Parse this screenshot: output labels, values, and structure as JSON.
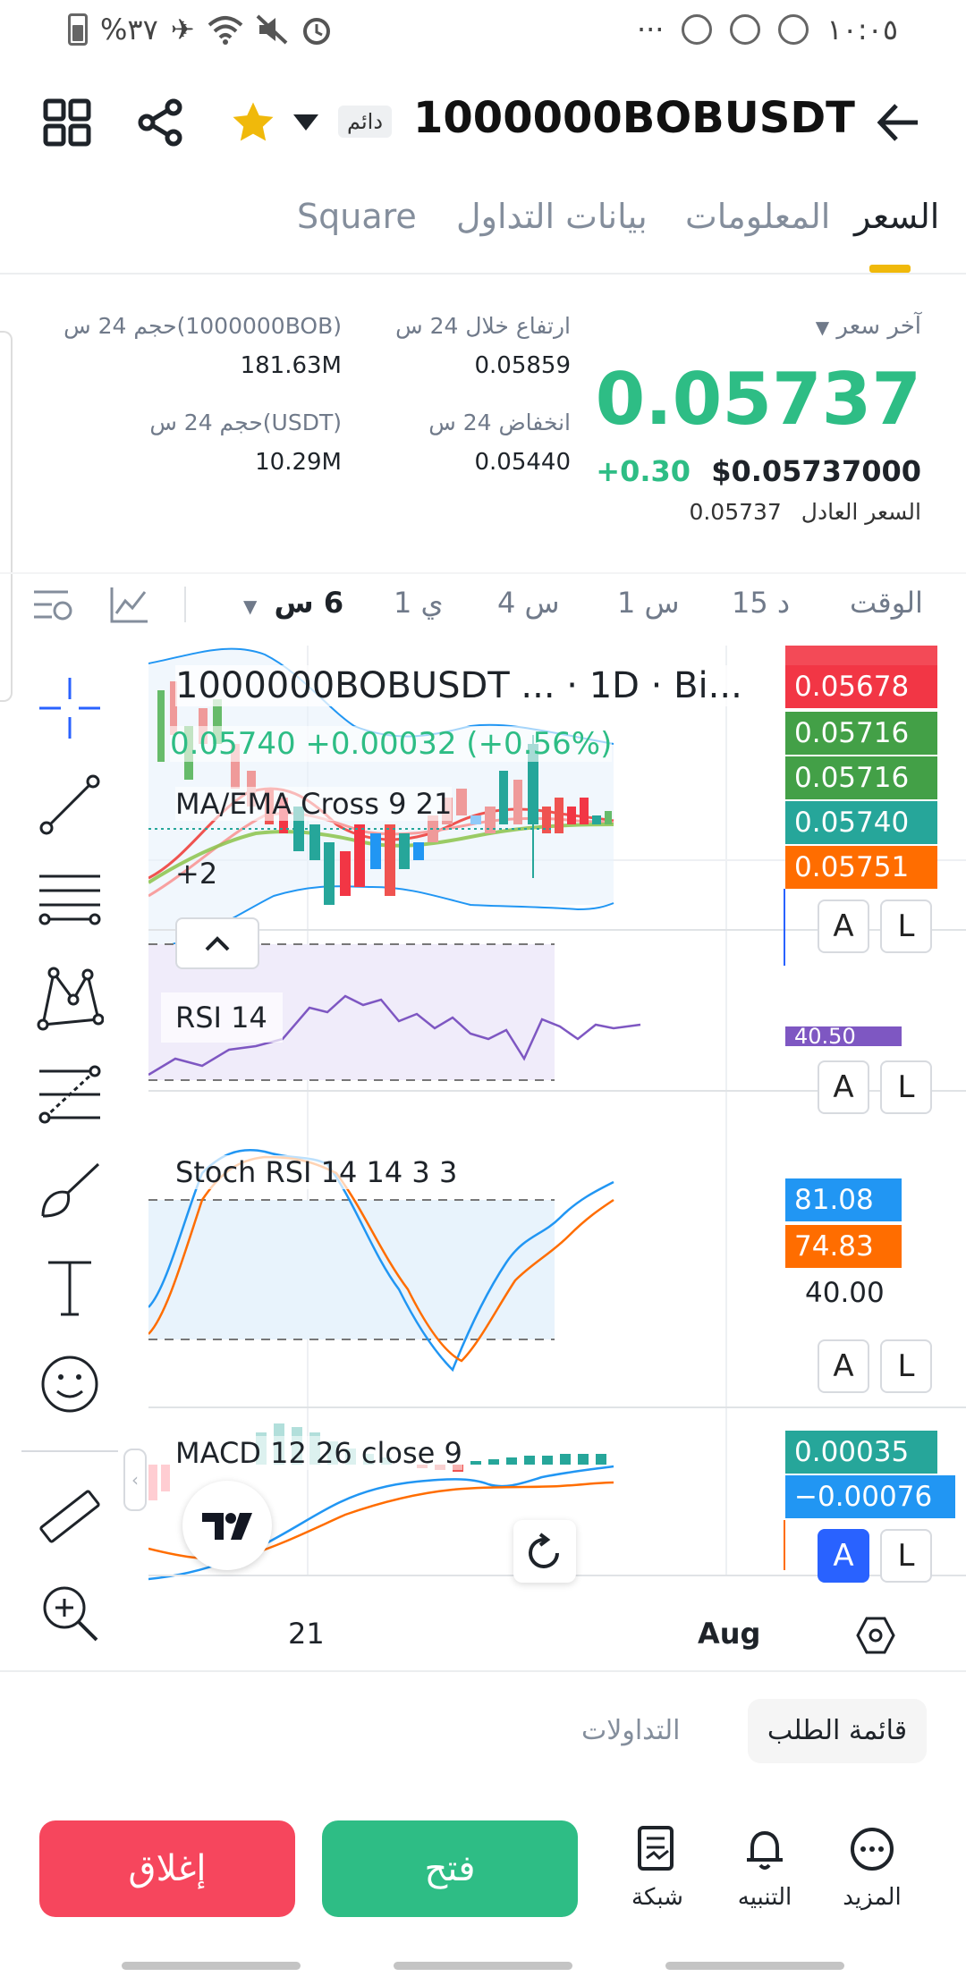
{
  "status_bar": {
    "battery_pct": "%٣٧",
    "time": "١٠:٠٥",
    "dots": "···"
  },
  "header": {
    "pair": "1000000BOBUSDT",
    "badge": "دائم"
  },
  "tabs": [
    {
      "label": "السعر"
    },
    {
      "label": "المعلومات"
    },
    {
      "label": "بيانات التداول"
    },
    {
      "label": "Square"
    }
  ],
  "price": {
    "last_label": "آخر سعر",
    "value": "0.05737",
    "change": "+0.30",
    "usd": "$0.05737000",
    "fair_label": "السعر العادل",
    "fair_value": "0.05737"
  },
  "stats": {
    "high_label": "ارتفاع خلال 24 س",
    "high_val": "0.05859",
    "low_label": "انخفاض 24 س",
    "low_val": "0.05440",
    "vol1_label": "حجم 24 س(1000000BOB)",
    "vol1_val": "181.63M",
    "vol2_label": "حجم 24 س(USDT)",
    "vol2_val": "10.29M"
  },
  "timeframes": {
    "label": "الوقت",
    "items": [
      "15 د",
      "1 س",
      "4 س",
      "1 ي",
      "6 س"
    ]
  },
  "chart": {
    "title": "1000000BOBUSDT ... · 1D · Bi...",
    "ohlc": "0.05740  +0.00032 (+0.56%)",
    "ma_label": "MA/EMA Cross 9 21",
    "plus": "+2",
    "rsi_label": "RSI 14",
    "rsi_val": "40.50",
    "stoch_label": "Stoch RSI 14 14 3 3",
    "macd_label": "MACD 12 26 close 9",
    "date1": "21",
    "date2": "Aug",
    "main_tags": [
      {
        "text": "0.05678",
        "color": "#f23645"
      },
      {
        "text": "0.05716",
        "color": "#43a047"
      },
      {
        "text": "0.05716",
        "color": "#43a047"
      },
      {
        "text": "0.05740",
        "color": "#26a69a"
      },
      {
        "text": "0.05751",
        "color": "#ff6d00"
      }
    ],
    "stoch_tags": [
      {
        "text": "81.08",
        "color": "#2196f3"
      },
      {
        "text": "74.83",
        "color": "#ff6d00"
      }
    ],
    "stoch_level": "40.00",
    "macd_tags": [
      {
        "text": "0.00035",
        "color": "#26a69a"
      },
      {
        "text": "−0.00076",
        "color": "#2196f3"
      }
    ],
    "btn_a": "A",
    "btn_l": "L"
  },
  "bottom": {
    "orderbook": "قائمة الطلب",
    "trades": "التداولات",
    "close_btn": "إغلاق",
    "open_btn": "فتح",
    "grid": "شبكة",
    "alert": "التنبيه",
    "more": "المزيد"
  }
}
